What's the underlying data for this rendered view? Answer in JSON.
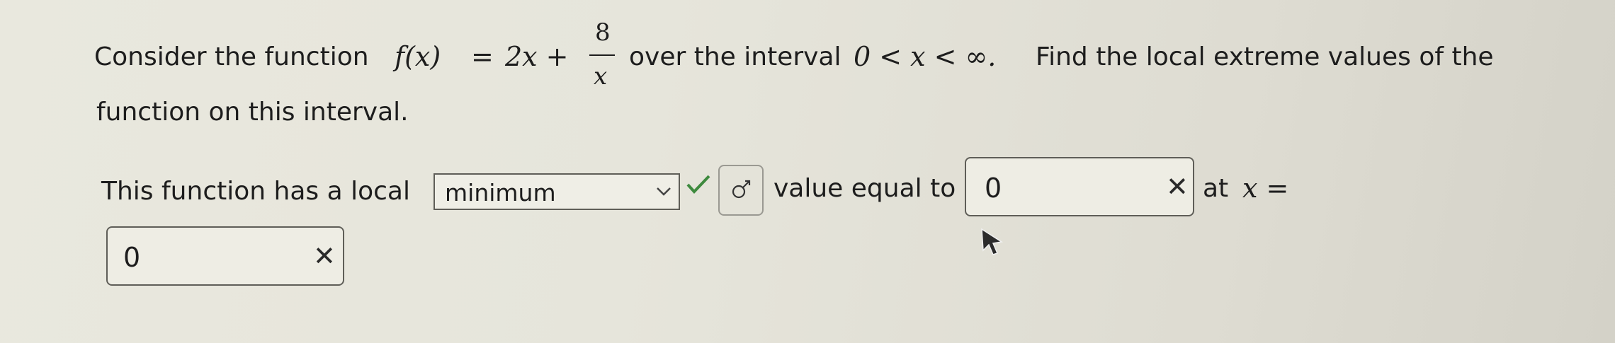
{
  "question": {
    "text_before_func": "Consider the function",
    "func_lhs": "f(x)",
    "equals": "=",
    "func_term": "2x +",
    "frac_numerator": "8",
    "frac_denominator": "x",
    "text_after_func": "over the interval",
    "interval": "0 < x < ∞.",
    "text_end": "Find the local extreme values of the",
    "line2": "function on this interval."
  },
  "answer": {
    "prefix": "This function has a local",
    "dropdown_value": "minimum",
    "dropdown_status": "correct",
    "value_text": "value equal to",
    "value_input": "0",
    "value_status": "incorrect",
    "at_text": "at",
    "at_var": "x =",
    "x_input": "0",
    "x_status": "incorrect"
  },
  "icons": {
    "dropdown_arrow": "chevron-down-icon",
    "correct_mark": "checkmark-icon",
    "gender_symbol": "symbol-icon",
    "incorrect_mark": "x-mark-icon",
    "cursor": "mouse-pointer-icon"
  },
  "colors": {
    "correct": "#3e8a3e",
    "incorrect": "#2a2a2a"
  }
}
